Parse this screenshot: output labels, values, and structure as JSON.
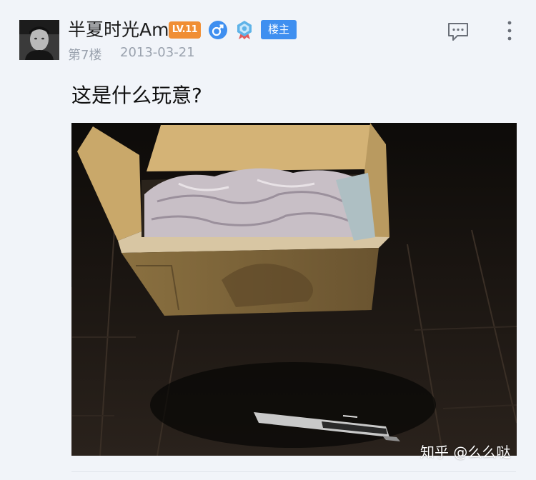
{
  "post": {
    "username": "半夏时光Am",
    "level_badge": "LV.11",
    "owner_badge": "楼主",
    "floor": "第7楼",
    "date": "2013-03-21",
    "text": "这是什么玩意?"
  },
  "icons": {
    "gender": "male-symbol-icon",
    "medal": "medal-icon",
    "comment": "comment-icon",
    "more": "more-vertical-icon"
  },
  "watermark": "知乎 @么么哒",
  "colors": {
    "level_badge": "#f08e34",
    "owner_badge": "#3f8ff0",
    "gender_icon": "#3f8ff0",
    "meta_text": "#9aa2ae"
  }
}
